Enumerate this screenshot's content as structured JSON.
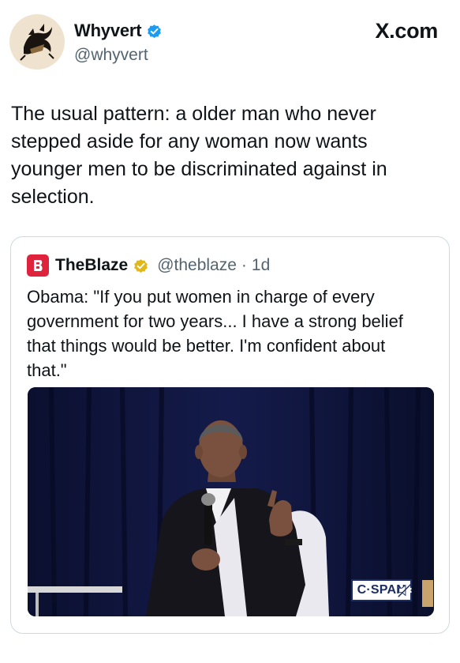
{
  "author": {
    "display_name": "Whyvert",
    "handle": "@whyvert",
    "verified_color": "#1d9bf0",
    "avatar_icon": "dragon-emblem-avatar"
  },
  "site": {
    "label": "X.com"
  },
  "tweet": {
    "text": "The usual pattern: a older man who never stepped aside for any woman now wants younger men to be discriminated against in selection."
  },
  "quote": {
    "display_name": "TheBlaze",
    "handle": "@theblaze",
    "separator": "·",
    "time": "1d",
    "badge_color": "#e2b719",
    "brand_color": "#e0233d",
    "text": "Obama: \"If you put women in charge of every government for two years... I have a strong belief that things would be better. I'm confident about that.\"",
    "video": {
      "watermark": "C·SPAN",
      "muted": true
    }
  }
}
